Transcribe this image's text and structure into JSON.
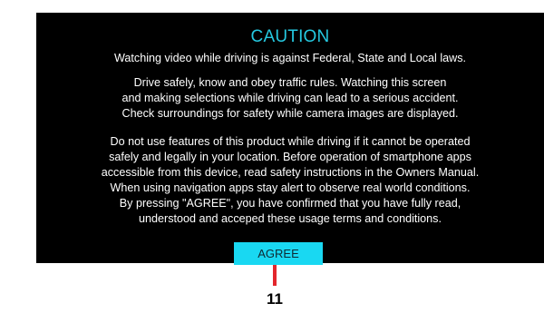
{
  "dialog": {
    "title": "CAUTION",
    "paragraph1": [
      "Watching video while driving is against Federal, State and Local laws."
    ],
    "paragraph2": [
      "Drive safely, know and obey traffic rules. Watching this screen",
      "and making selections while driving can lead to a serious accident.",
      "Check surroundings for safety while camera images are displayed."
    ],
    "paragraph3": [
      "Do not use features of this product while driving if it cannot be operated",
      "safely and legally in your location. Before operation of smartphone apps",
      "accessible from this device, read safety instructions in the Owners Manual.",
      "When using navigation apps stay alert to observe real world conditions.",
      "By pressing \"AGREE\", you have confirmed that you have fully read,",
      "understood and acceped these usage terms and conditions."
    ],
    "agree_label": "AGREE"
  },
  "callout": {
    "number": "11"
  },
  "colors": {
    "screen_bg": "#000000",
    "title": "#25c8e0",
    "button_bg": "#19d8f2",
    "callout_line": "#e3262c"
  }
}
